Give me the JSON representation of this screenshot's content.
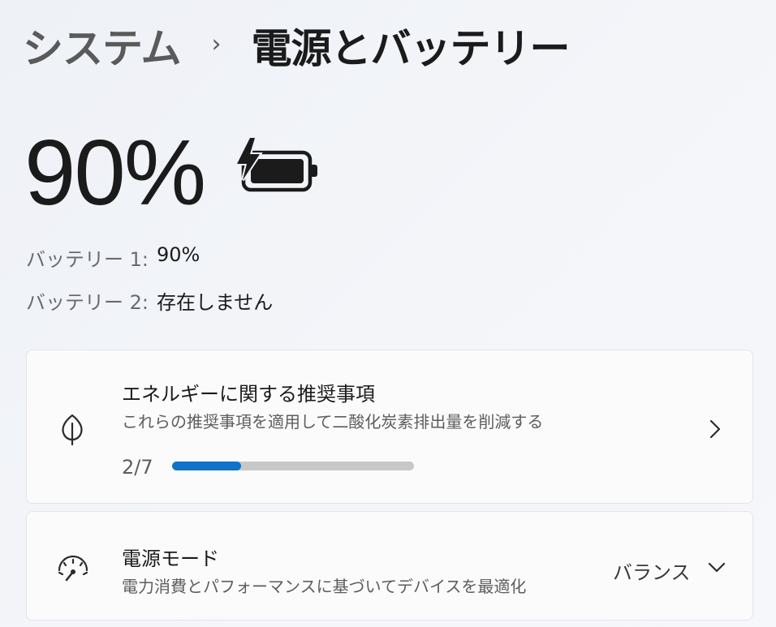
{
  "breadcrumb": {
    "parent": "システム",
    "separator": "›",
    "current": "電源とバッテリー"
  },
  "battery": {
    "percent_text": "90%",
    "percent_value": 90,
    "icon": "battery-charging-icon",
    "rows": [
      {
        "label": "バッテリー 1:",
        "value": "90%"
      },
      {
        "label": "バッテリー 2:",
        "value": "存在しません"
      }
    ]
  },
  "energy_card": {
    "icon": "leaf-icon",
    "title": "エネルギーに関する推奨事項",
    "subtitle": "これらの推奨事項を適用して二酸化炭素排出量を削減する",
    "progress_text": "2/7",
    "progress_fraction": 0.2857,
    "accent": "#1172c8"
  },
  "power_card": {
    "icon": "gauge-icon",
    "title": "電源モード",
    "subtitle": "電力消費とパフォーマンスに基づいてデバイスを最適化",
    "selected_value": "バランス"
  }
}
